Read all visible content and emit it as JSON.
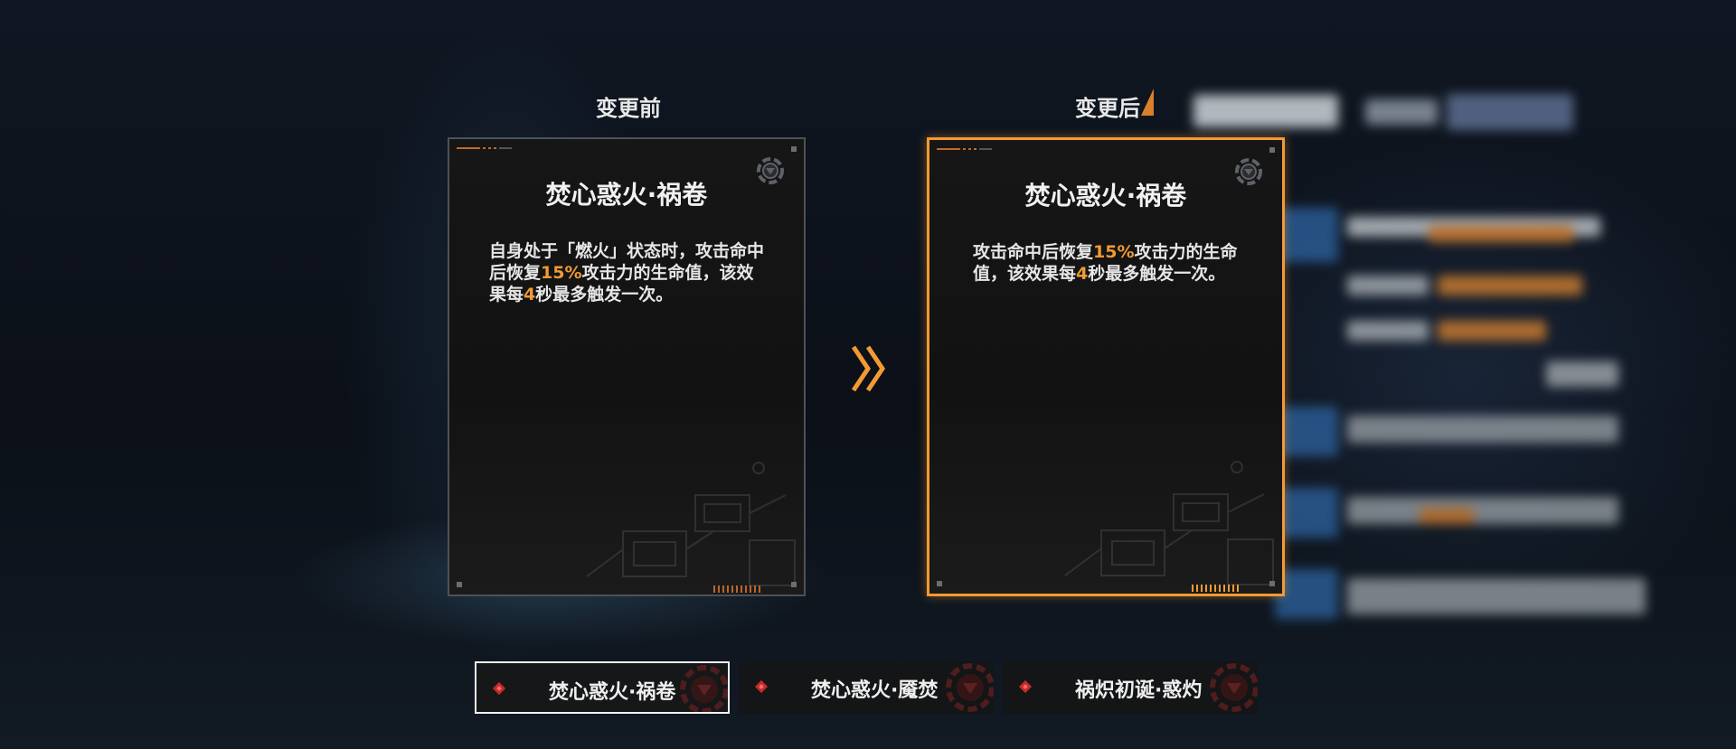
{
  "compare": {
    "before_title": "变更前",
    "after_title": "变更后"
  },
  "cards": {
    "before": {
      "name": "焚心惑火·祸卷",
      "desc_parts": [
        "自身处于「燃火」状态时，攻击命中后恢复",
        "15%",
        "攻击力的生命值，该效果每",
        "4",
        "秒最多触发一次。"
      ]
    },
    "after": {
      "name": "焚心惑火·祸卷",
      "desc_parts": [
        "攻击命中后恢复",
        "15%",
        "攻击力的生命值，该效果每",
        "4",
        "秒最多触发一次。"
      ]
    }
  },
  "tabs": [
    {
      "label": "焚心惑火·祸卷",
      "active": true
    },
    {
      "label": "焚心惑火·魇焚",
      "active": false
    },
    {
      "label": "祸炽初诞·惑灼",
      "active": false
    }
  ],
  "colors": {
    "accent": "#f39a32",
    "diamond": "#c42a2a"
  },
  "icons": {
    "card": "settings-gear-icon",
    "transition": "double-chevron-right-icon",
    "tab_marker": "diamond-icon",
    "tab_emblem": "gear-emblem-icon"
  }
}
